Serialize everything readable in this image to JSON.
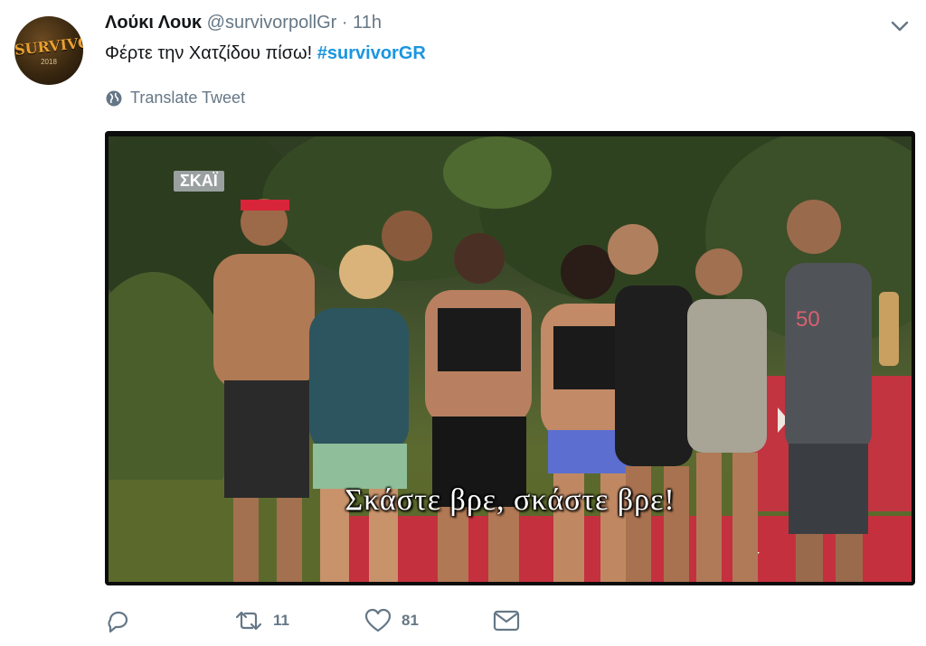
{
  "tweet": {
    "author_name": "Λούκι Λουκ",
    "handle": "@survivorpollGr",
    "separator": "·",
    "time": "11h",
    "text": "Φέρτε την Χατζίδου πίσω!",
    "hashtag": "#survivorGR",
    "translate_label": "Translate Tweet"
  },
  "avatar": {
    "text": "SURVIVOR",
    "sub": "2018"
  },
  "media": {
    "watermark": "ΣΚΑΪ",
    "subtitle": "Σκάστε βρε, σκάστε βρε!"
  },
  "actions": {
    "retweet_count": "11",
    "like_count": "81"
  },
  "colors": {
    "link": "#1b95e0",
    "secondary": "#657786",
    "text": "#14171a"
  },
  "icons": [
    "chevron-down-icon",
    "globe-icon",
    "reply-icon",
    "retweet-icon",
    "like-icon",
    "message-icon"
  ]
}
